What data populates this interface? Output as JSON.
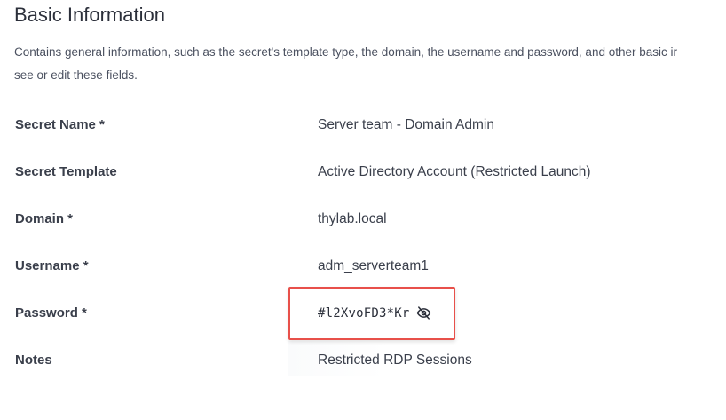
{
  "section": {
    "title": "Basic Information",
    "description_line1": "Contains general information, such as the secret's template type, the domain, the username and password, and other basic ir",
    "description_line2": "see or edit these fields."
  },
  "fields": [
    {
      "label": "Secret Name *",
      "value": "Server team - Domain Admin"
    },
    {
      "label": "Secret Template",
      "value": "Active Directory Account (Restricted Launch)"
    },
    {
      "label": "Domain *",
      "value": "thylab.local"
    },
    {
      "label": "Username *",
      "value": "adm_serverteam1"
    },
    {
      "label": "Password *",
      "value": "#l2XvoFD3*Kr",
      "toggle_icon": "eye-slash-icon"
    },
    {
      "label": "Notes",
      "value": "Restricted RDP Sessions"
    }
  ],
  "highlight": {
    "color": "#e8504a",
    "target": "Password *"
  }
}
